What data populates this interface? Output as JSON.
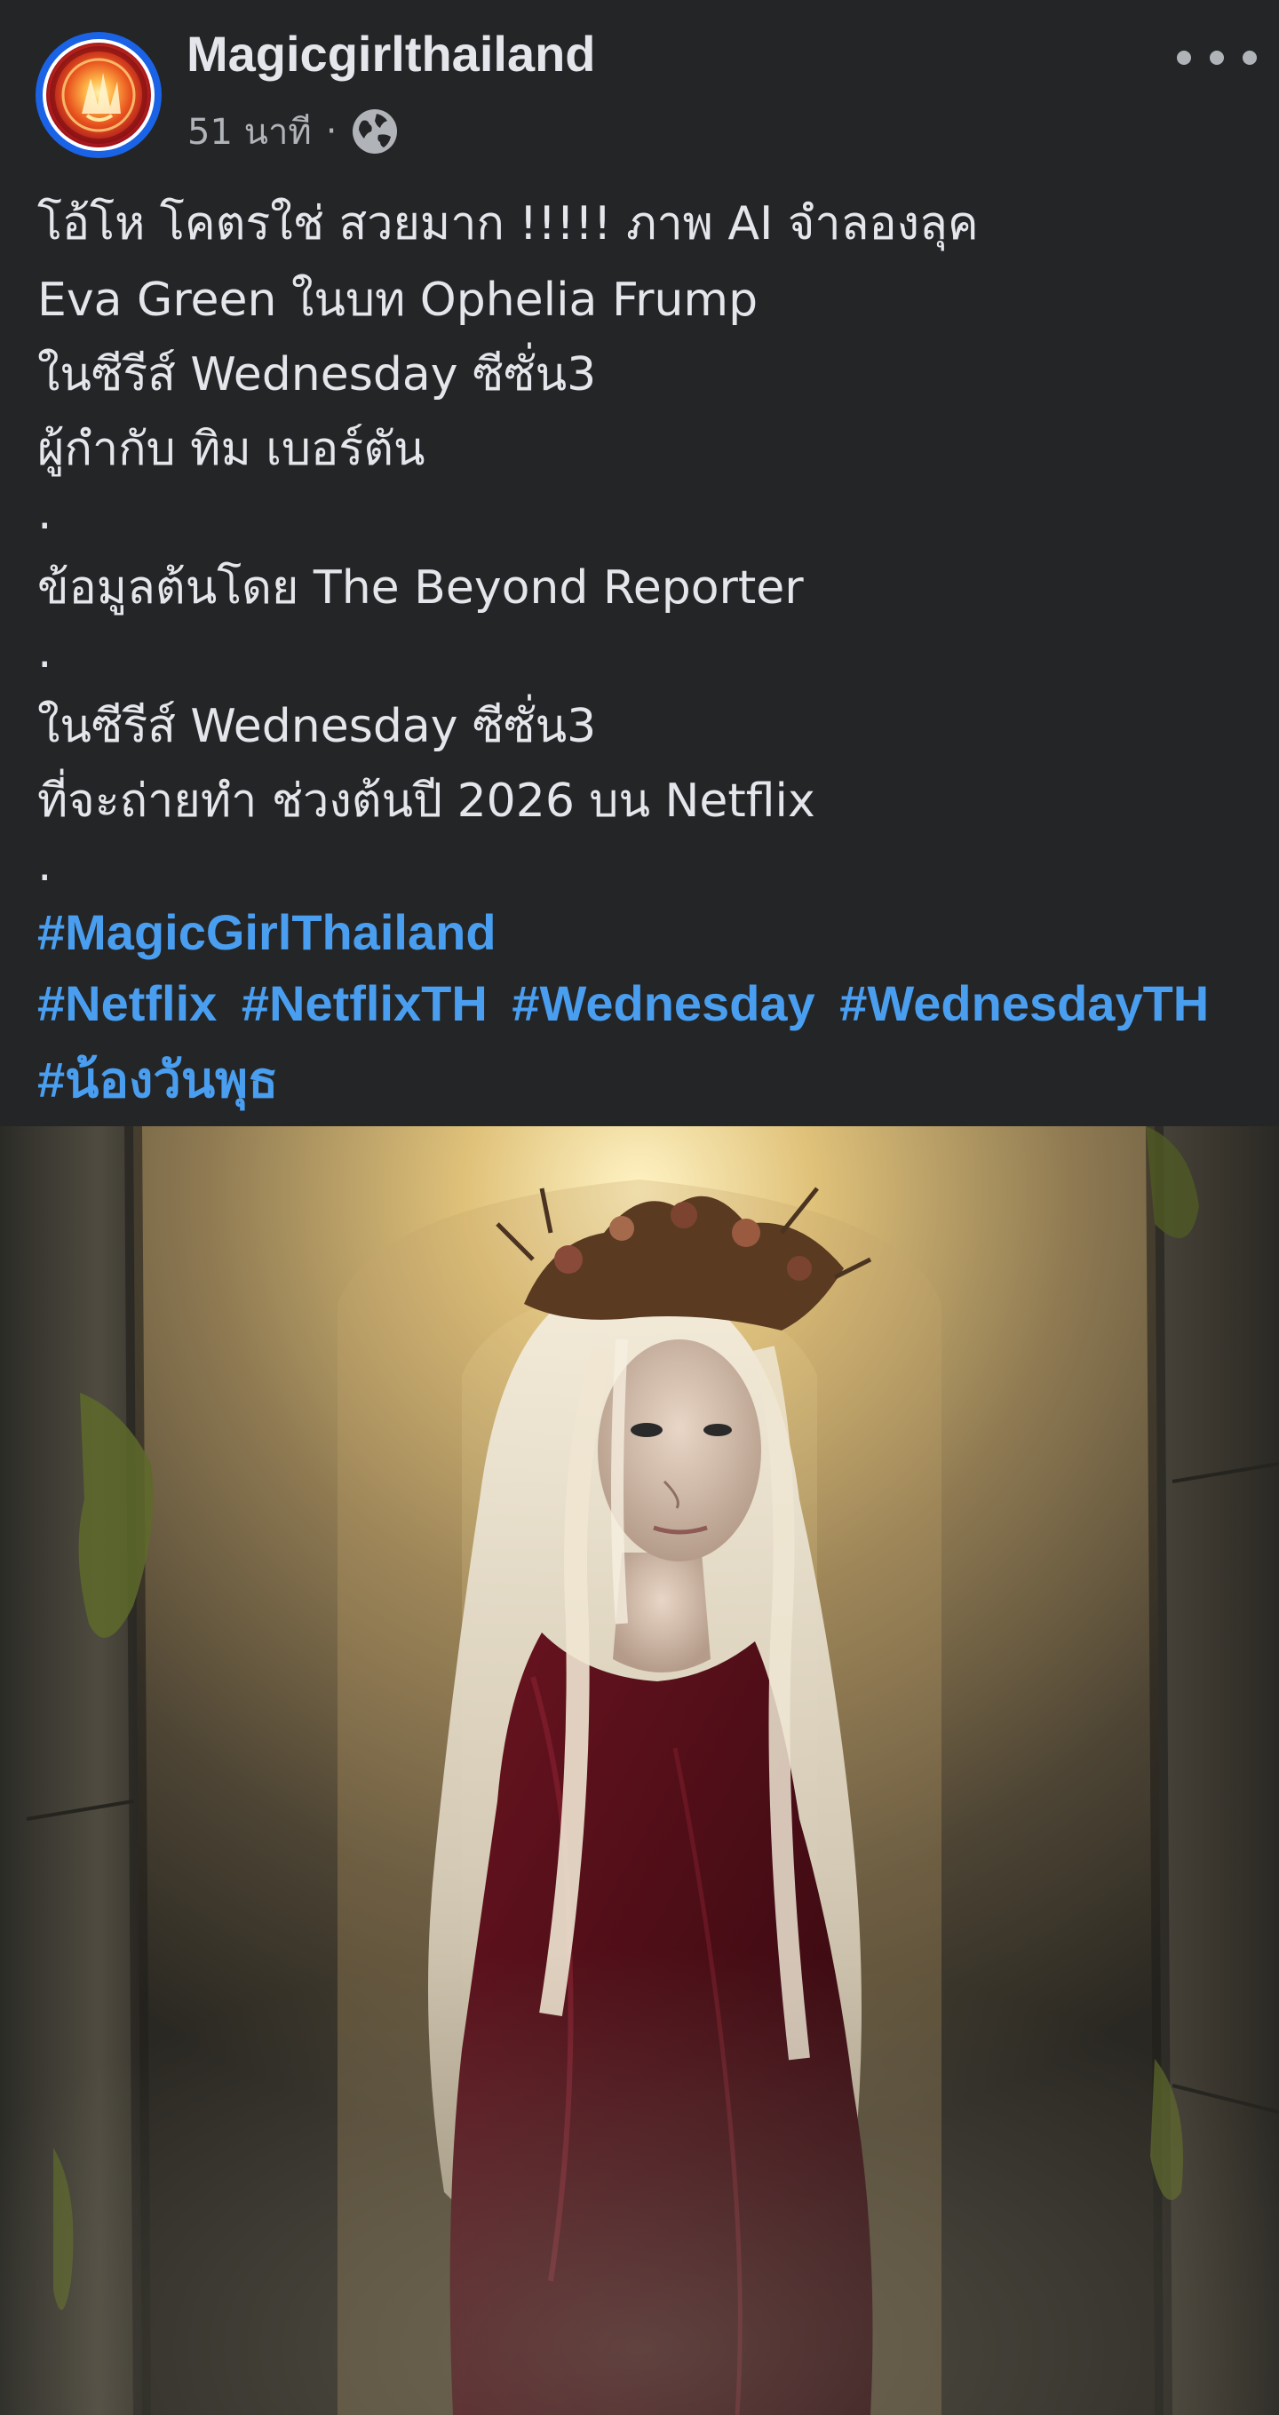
{
  "post": {
    "page_name": "Magicgirlthailand",
    "timestamp": "51 นาที",
    "separator": "·",
    "privacy_icon": "globe-icon",
    "more_icon": "more-horizontal-icon",
    "body_lines": [
      "โอ้โห โคตรใช่ สวยมาก !!!!! ภาพ AI จำลองลุค",
      "Eva Green ในบท Ophelia Frump",
      "ในซีรีส์ Wednesday ซีซั่น3",
      "ผู้กำกับ ทิม เบอร์ตัน",
      ".",
      "ข้อมูลต้นโดย The Beyond Reporter",
      ".",
      "ในซีรีส์ Wednesday ซีซั่น3",
      "ที่จะถ่ายทำ ช่วงต้นปี 2026 บน Netflix",
      "."
    ],
    "hashtags": {
      "line1": [
        "#MagicGirlThailand"
      ],
      "line2": [
        "#Netflix",
        "#NetflixTH",
        "#Wednesday",
        "#WednesdayTH"
      ],
      "line3": [
        "#น้องวันพุธ"
      ]
    },
    "colors": {
      "background": "#242526",
      "text": "#e4e6eb",
      "secondary_text": "#b0b3b8",
      "hashtag": "#4a9ef0",
      "avatar_ring": "#1b63e6"
    }
  }
}
